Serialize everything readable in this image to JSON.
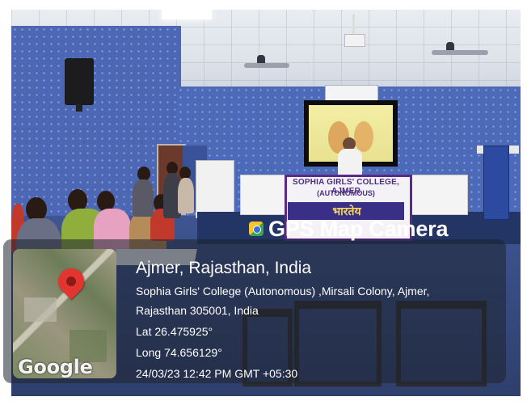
{
  "overlay": {
    "brand": "GPS Map Camera",
    "location_title": "Ajmer, Rajasthan, India",
    "address_line1": "Sophia Girls' College (Autonomous) ,Mirsali Colony, Ajmer,",
    "address_line2": "Rajasthan 305001, India",
    "latitude": "Lat 26.475925°",
    "longitude": "Long 74.656129°",
    "datetime": "24/03/23 12:42 PM GMT +05:30",
    "map_attribution": "Google"
  },
  "scene": {
    "banner_line1": "SOPHIA GIRLS' COLLEGE, AJMER",
    "banner_line2": "(AUTONOMOUS)",
    "banner_hindi": "भारतेय"
  },
  "colors": {
    "wall": "#4d6ab8",
    "pin": "#e3342f",
    "banner_border": "#5b2a88"
  }
}
